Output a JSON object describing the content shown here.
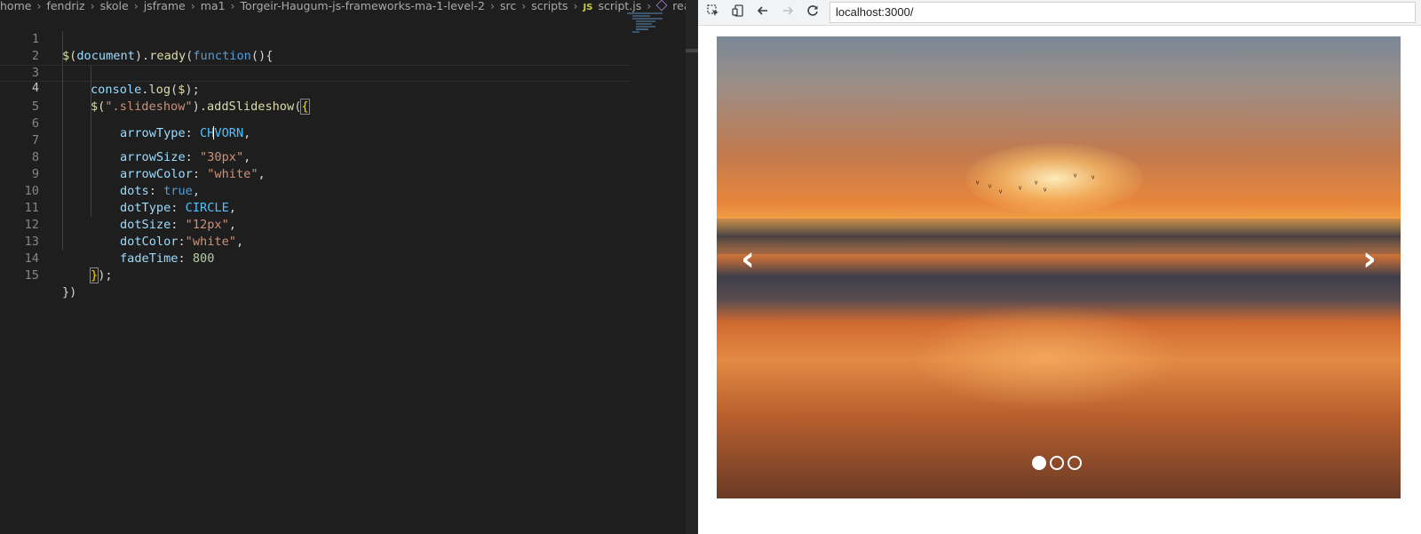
{
  "editor": {
    "breadcrumb": [
      "home",
      "fendriz",
      "skole",
      "jsframe",
      "ma1",
      "Torgeir-Haugum-js-frameworks-ma-1-level-2",
      "src",
      "scripts",
      "script.js",
      "ready("
    ],
    "js_badge": "JS",
    "line_numbers": [
      "1",
      "2",
      "3",
      "4",
      "5",
      "6",
      "7",
      "8",
      "9",
      "10",
      "11",
      "12",
      "13",
      "14",
      "15"
    ],
    "current_line": "4",
    "code": {
      "l1_a": "$(",
      "l1_b": "document",
      "l1_c": ").",
      "l1_d": "ready",
      "l1_e": "(",
      "l1_f": "function",
      "l1_g": "(){",
      "l2_a": "console",
      "l2_b": ".",
      "l2_c": "log",
      "l2_d": "(",
      "l2_e": "$",
      "l2_f": ");",
      "l3_a": "$(",
      "l3_b": "\".slideshow\"",
      "l3_c": ").",
      "l3_d": "addSlideshow",
      "l3_e": "(",
      "l3_f": "{",
      "l4_a": "arrowType",
      "l4_b": ": ",
      "l4_c1": "CH",
      "l4_c2": "VORN",
      "l4_d": ",",
      "l5_a": "arrowSize",
      "l5_b": ": ",
      "l5_c": "\"30px\"",
      "l5_d": ",",
      "l6_a": "arrowColor",
      "l6_b": ": ",
      "l6_c": "\"white\"",
      "l6_d": ",",
      "l7_a": "dots",
      "l7_b": ": ",
      "l7_c": "true",
      "l7_d": ",",
      "l8_a": "dotType",
      "l8_b": ": ",
      "l8_c": "CIRCLE",
      "l8_d": ",",
      "l9_a": "dotSize",
      "l9_b": ": ",
      "l9_c": "\"12px\"",
      "l9_d": ",",
      "l10_a": "dotColor",
      "l10_b": ":",
      "l10_c": "\"white\"",
      "l10_d": ",",
      "l11_a": "fadeTime",
      "l11_b": ": ",
      "l11_c": "800",
      "l13_a": "}",
      "l13_b": ");",
      "l15_a": "})"
    }
  },
  "browser": {
    "url": "localhost:3000/",
    "toolbar_icons": [
      "inspect-icon",
      "device-toggle-icon",
      "back-icon",
      "forward-icon",
      "reload-icon"
    ],
    "slideshow": {
      "prev_arrow": "‹",
      "next_arrow": "›",
      "dots_total": 3,
      "active_dot_index": 0
    }
  },
  "colors": {
    "editor_bg": "#1e1e1e",
    "keyword": "#569cd6",
    "string": "#ce9178",
    "property": "#9cdcfe",
    "function": "#dcdcaa",
    "number": "#b5cea8",
    "browser_toolbar": "#f1f3f4"
  }
}
